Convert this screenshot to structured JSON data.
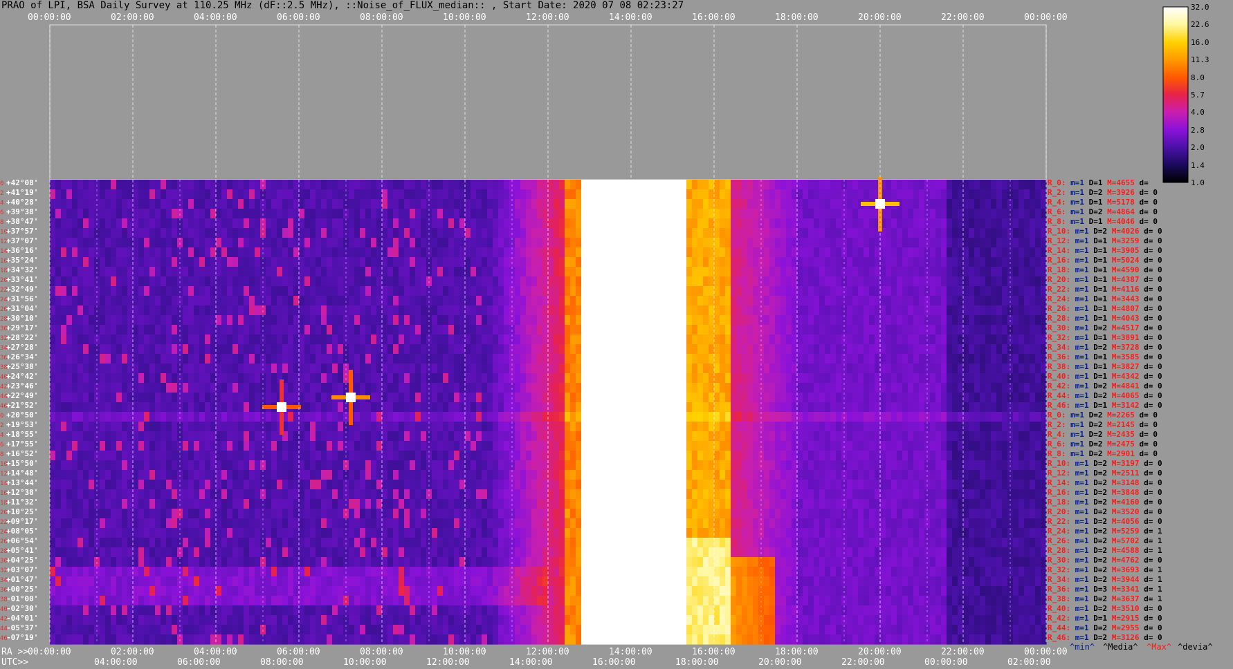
{
  "title": "PRAO of LPI, BSA Daily Survey at 110.25 MHz (dF::2.5 MHz), ::Noise_of_FLUX_median:: , Start Date: 2020 07 08 02:23:27",
  "top_ticks": [
    "00:00:00",
    "02:00:00",
    "04:00:00",
    "06:00:00",
    "08:00:00",
    "10:00:00",
    "12:00:00",
    "14:00:00",
    "16:00:00",
    "18:00:00",
    "20:00:00",
    "22:00:00",
    "00:00:00"
  ],
  "ra_label": "RA >>",
  "ra_ticks": [
    "00:00:00",
    "02:00:00",
    "04:00:00",
    "06:00:00",
    "08:00:00",
    "10:00:00",
    "12:00:00",
    "14:00:00",
    "16:00:00",
    "18:00:00",
    "20:00:00",
    "22:00:00",
    "00:00:00"
  ],
  "utc_label": "UTC>>",
  "utc_ticks": [
    "04:00:00",
    "06:00:00",
    "08:00:00",
    "10:00:00",
    "12:00:00",
    "14:00:00",
    "16:00:00",
    "18:00:00",
    "20:00:00",
    "22:00:00",
    "00:00:00",
    "02:00:00"
  ],
  "declinations": [
    "+42°08'",
    "+41°19'",
    "+40°28'",
    "+39°38'",
    "+38°47'",
    "+37°57'",
    "+37°07'",
    "+36°16'",
    "+35°24'",
    "+34°32'",
    "+33°41'",
    "+32°49'",
    "+31°56'",
    "+31°04'",
    "+30°10'",
    "+29°17'",
    "+28°22'",
    "+27°28'",
    "+26°34'",
    "+25°38'",
    "+24°42'",
    "+23°46'",
    "+22°49'",
    "+21°52'",
    "+20°50'",
    "+19°53'",
    "+18°55'",
    "+17°55'",
    "+16°52'",
    "+15°50'",
    "+14°48'",
    "+13°44'",
    "+12°38'",
    "+11°32'",
    "+10°25'",
    "+09°17'",
    "+08°05'",
    "+06°54'",
    "+05°41'",
    "+04°25'",
    "+03°07'",
    "+01°47'",
    "+00°25'",
    "-01°00'",
    "-02°30'",
    "-04°01'",
    "-05°37'",
    "-07°19'"
  ],
  "row_numbers": [
    "0",
    "2",
    "4",
    "6",
    "8",
    "10",
    "12",
    "14",
    "16",
    "18",
    "20",
    "22",
    "24",
    "26",
    "28",
    "30",
    "32",
    "34",
    "36",
    "38",
    "40",
    "42",
    "44",
    "46",
    "0",
    "2",
    "4",
    "6",
    "8",
    "10",
    "12",
    "14",
    "16",
    "18",
    "20",
    "22",
    "24",
    "26",
    "28",
    "30",
    "32",
    "34",
    "36",
    "38",
    "40",
    "42",
    "44",
    "46"
  ],
  "stats": [
    {
      "r": "R_0:",
      "m": "m=1",
      "D": "D=1",
      "M": "M=4655",
      "d": "d="
    },
    {
      "r": "R_2:",
      "m": "m=1",
      "D": "D=2",
      "M": "M=3926",
      "d": "d= 0"
    },
    {
      "r": "R_4:",
      "m": "m=1",
      "D": "D=1",
      "M": "M=5178",
      "d": "d= 0"
    },
    {
      "r": "R_6:",
      "m": "m=1",
      "D": "D=2",
      "M": "M=4864",
      "d": "d= 0"
    },
    {
      "r": "R_8:",
      "m": "m=1",
      "D": "D=1",
      "M": "M=4046",
      "d": "d= 0"
    },
    {
      "r": "R_10:",
      "m": "m=1",
      "D": "D=2",
      "M": "M=4026",
      "d": "d= 0"
    },
    {
      "r": "R_12:",
      "m": "m=1",
      "D": "D=1",
      "M": "M=3259",
      "d": "d= 0"
    },
    {
      "r": "R_14:",
      "m": "m=1",
      "D": "D=1",
      "M": "M=3905",
      "d": "d= 0"
    },
    {
      "r": "R_16:",
      "m": "m=1",
      "D": "D=1",
      "M": "M=5024",
      "d": "d= 0"
    },
    {
      "r": "R_18:",
      "m": "m=1",
      "D": "D=1",
      "M": "M=4590",
      "d": "d= 0"
    },
    {
      "r": "R_20:",
      "m": "m=1",
      "D": "D=1",
      "M": "M=4387",
      "d": "d= 0"
    },
    {
      "r": "R_22:",
      "m": "m=1",
      "D": "D=1",
      "M": "M=4116",
      "d": "d= 0"
    },
    {
      "r": "R_24:",
      "m": "m=1",
      "D": "D=1",
      "M": "M=3443",
      "d": "d= 0"
    },
    {
      "r": "R_26:",
      "m": "m=1",
      "D": "D=1",
      "M": "M=4807",
      "d": "d= 0"
    },
    {
      "r": "R_28:",
      "m": "m=1",
      "D": "D=1",
      "M": "M=4043",
      "d": "d= 0"
    },
    {
      "r": "R_30:",
      "m": "m=1",
      "D": "D=2",
      "M": "M=4517",
      "d": "d= 0"
    },
    {
      "r": "R_32:",
      "m": "m=1",
      "D": "D=1",
      "M": "M=3891",
      "d": "d= 0"
    },
    {
      "r": "R_34:",
      "m": "m=1",
      "D": "D=2",
      "M": "M=3728",
      "d": "d= 0"
    },
    {
      "r": "R_36:",
      "m": "m=1",
      "D": "D=1",
      "M": "M=3585",
      "d": "d= 0"
    },
    {
      "r": "R_38:",
      "m": "m=1",
      "D": "D=1",
      "M": "M=3827",
      "d": "d= 0"
    },
    {
      "r": "R_40:",
      "m": "m=1",
      "D": "D=1",
      "M": "M=4342",
      "d": "d= 0"
    },
    {
      "r": "R_42:",
      "m": "m=1",
      "D": "D=2",
      "M": "M=4841",
      "d": "d= 0"
    },
    {
      "r": "R_44:",
      "m": "m=1",
      "D": "D=2",
      "M": "M=4065",
      "d": "d= 0"
    },
    {
      "r": "R_46:",
      "m": "m=1",
      "D": "D=1",
      "M": "M=3142",
      "d": "d= 0"
    },
    {
      "r": "R_0:",
      "m": "m=1",
      "D": "D=2",
      "M": "M=2265",
      "d": "d= 0"
    },
    {
      "r": "R_2:",
      "m": "m=1",
      "D": "D=2",
      "M": "M=2145",
      "d": "d= 0"
    },
    {
      "r": "R_4:",
      "m": "m=1",
      "D": "D=2",
      "M": "M=2435",
      "d": "d= 0"
    },
    {
      "r": "R_6:",
      "m": "m=1",
      "D": "D=2",
      "M": "M=2475",
      "d": "d= 0"
    },
    {
      "r": "R_8:",
      "m": "m=1",
      "D": "D=2",
      "M": "M=2901",
      "d": "d= 0"
    },
    {
      "r": "R_10:",
      "m": "m=1",
      "D": "D=2",
      "M": "M=3197",
      "d": "d= 0"
    },
    {
      "r": "R_12:",
      "m": "m=1",
      "D": "D=2",
      "M": "M=2511",
      "d": "d= 0"
    },
    {
      "r": "R_14:",
      "m": "m=1",
      "D": "D=2",
      "M": "M=3148",
      "d": "d= 0"
    },
    {
      "r": "R_16:",
      "m": "m=1",
      "D": "D=2",
      "M": "M=3848",
      "d": "d= 0"
    },
    {
      "r": "R_18:",
      "m": "m=1",
      "D": "D=2",
      "M": "M=4160",
      "d": "d= 0"
    },
    {
      "r": "R_20:",
      "m": "m=1",
      "D": "D=2",
      "M": "M=3520",
      "d": "d= 0"
    },
    {
      "r": "R_22:",
      "m": "m=1",
      "D": "D=2",
      "M": "M=4056",
      "d": "d= 0"
    },
    {
      "r": "R_24:",
      "m": "m=1",
      "D": "D=2",
      "M": "M=5259",
      "d": "d= 1"
    },
    {
      "r": "R_26:",
      "m": "m=1",
      "D": "D=2",
      "M": "M=5702",
      "d": "d= 1"
    },
    {
      "r": "R_28:",
      "m": "m=1",
      "D": "D=2",
      "M": "M=4588",
      "d": "d= 1"
    },
    {
      "r": "R_30:",
      "m": "m=1",
      "D": "D=2",
      "M": "M=4762",
      "d": "d= 0"
    },
    {
      "r": "R_32:",
      "m": "m=1",
      "D": "D=2",
      "M": "M=3693",
      "d": "d= 1"
    },
    {
      "r": "R_34:",
      "m": "m=1",
      "D": "D=2",
      "M": "M=3944",
      "d": "d= 1"
    },
    {
      "r": "R_36:",
      "m": "m=1",
      "D": "D=3",
      "M": "M=3341",
      "d": "d= 1"
    },
    {
      "r": "R_38:",
      "m": "m=1",
      "D": "D=2",
      "M": "M=3637",
      "d": "d= 1"
    },
    {
      "r": "R_40:",
      "m": "m=1",
      "D": "D=2",
      "M": "M=3510",
      "d": "d= 0"
    },
    {
      "r": "R_42:",
      "m": "m=1",
      "D": "D=1",
      "M": "M=2915",
      "d": "d= 0"
    },
    {
      "r": "R_44:",
      "m": "m=1",
      "D": "D=2",
      "M": "M=2955",
      "d": "d= 0"
    },
    {
      "r": "R_46:",
      "m": "m=1",
      "D": "D=2",
      "M": "M=3126",
      "d": "d= 0"
    }
  ],
  "legend_keys": {
    "min": "^min^",
    "media": "^Media^",
    "max": "^Max^",
    "devia": "^devia^"
  },
  "colorbar": {
    "ticks": [
      "32.0",
      "22.6",
      "16.0",
      "11.3",
      "8.0",
      "5.7",
      "4.0",
      "2.8",
      "2.0",
      "1.4",
      "1.0"
    ],
    "colors": [
      "#000000",
      "#1a0a5c",
      "#4a11a8",
      "#8a12d9",
      "#c81fb0",
      "#e8224a",
      "#ff5a00",
      "#ff9a00",
      "#ffd200",
      "#fff7a0",
      "#ffffff"
    ]
  },
  "chart_data": {
    "type": "heatmap",
    "title": "PRAO of LPI, BSA Daily Survey at 110.25 MHz (dF::2.5 MHz), ::Noise_of_FLUX_median:: , Start Date: 2020 07 08 02:23:27",
    "x_axis": "RA 00:00:00 to 00:00:00 (24 h)",
    "y_axis": "Declination +42°08' to -07°19' (48 beams)",
    "value_range": [
      1.0,
      32.0
    ],
    "scale": "log2",
    "features": [
      {
        "label": "Saturated band (Milky Way / Cyg region)",
        "ra_start": "12:45:00",
        "ra_end": "15:15:00",
        "value": 32.0
      },
      {
        "label": "Bright band",
        "ra_start": "15:15:00",
        "ra_end": "16:15:00",
        "value": 11.3
      },
      {
        "label": "Point source",
        "ra": "20:00:00",
        "dec": "+40°28'",
        "value": 22.6
      },
      {
        "label": "Point source",
        "ra": "07:15:00",
        "dec": "+22°49'",
        "value": 16.0
      },
      {
        "label": "Point source",
        "ra": "05:35:00",
        "dec": "+21°52'",
        "value": 11.3
      }
    ]
  }
}
